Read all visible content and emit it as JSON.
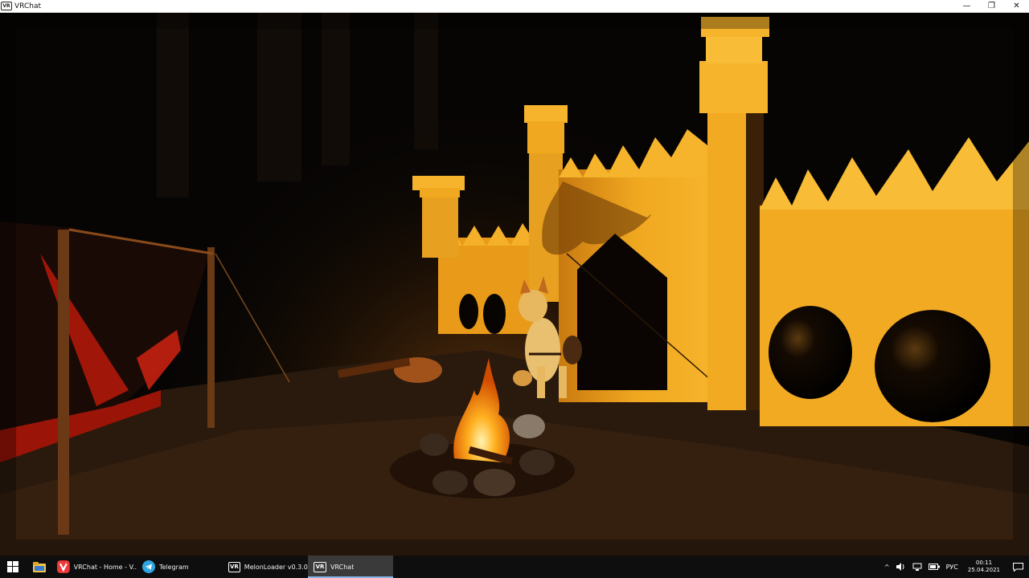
{
  "window": {
    "title": "VRChat",
    "icon": "VR",
    "controls": {
      "minimize": "—",
      "restore": "❐",
      "close": "✕"
    }
  },
  "taskbar": {
    "start_icon": "windows-logo-icon",
    "explorer_icon": "folder-icon",
    "apps": [
      {
        "label": "VRChat - Home - V...",
        "icon": "vivaldi-icon",
        "icon_color": "#ef3939",
        "active": false
      },
      {
        "label": "Telegram",
        "icon": "telegram-icon",
        "icon_color": "#2ea6df",
        "active": false
      },
      {
        "label": "MelonLoader v0.3.0...",
        "icon_text": "VR",
        "icon": "vrchat-icon",
        "active": false
      },
      {
        "label": "VRChat",
        "icon_text": "VR",
        "icon": "vrchat-icon",
        "active": true
      }
    ],
    "tray": {
      "chevron": "^",
      "language": "РУС",
      "time": "00:11",
      "date": "25.04.2021"
    }
  },
  "colors": {
    "taskbar_bg": "#0e0e0e",
    "active_underline": "#8ab4e8",
    "wall": "#f0a820",
    "fire": "#ffb020"
  }
}
